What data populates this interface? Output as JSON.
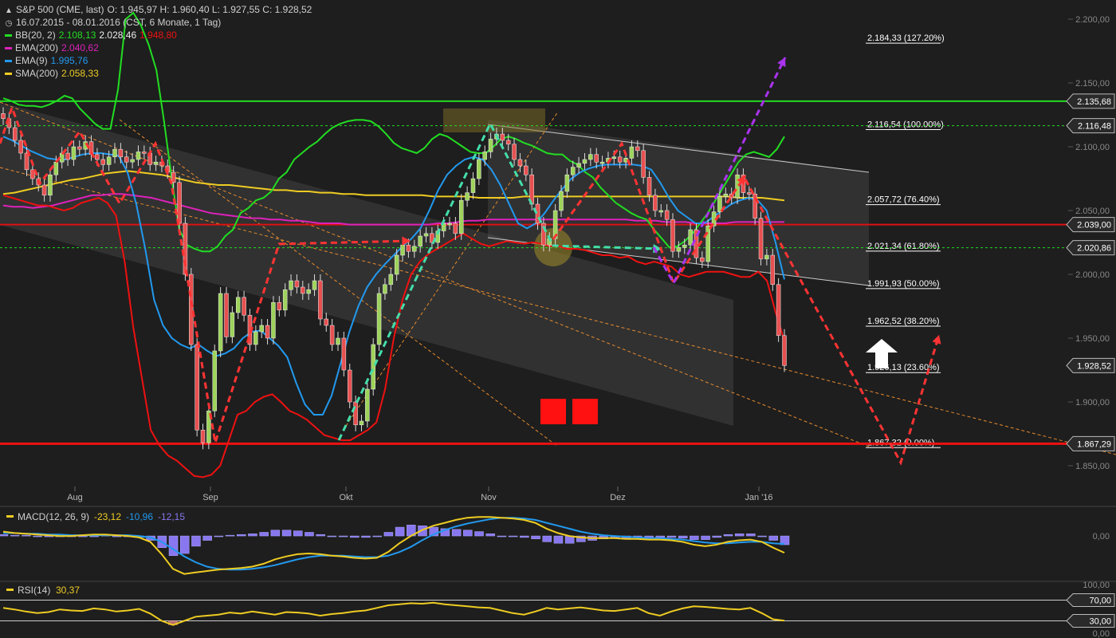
{
  "header": {
    "instrument": "S&P 500 (CME, last)",
    "ohlc": "O: 1.945,97  H: 1.960,40  L: 1.927,55  C: 1.928,52",
    "range": "16.07.2015 - 08.01.2016 (CST, 6 Monate, 1 Tag)",
    "indicators": [
      {
        "label": "BB(20, 2)",
        "values": [
          "2.108,13",
          "2.028,46",
          "1.948,80"
        ],
        "colors": [
          "#22dd22",
          "#eeeeee",
          "#ee1111"
        ]
      },
      {
        "label": "EMA(200)",
        "values": [
          "2.040,62"
        ],
        "colors": [
          "#dd22bb"
        ]
      },
      {
        "label": "EMA(9)",
        "values": [
          "1.995,76"
        ],
        "colors": [
          "#2299ee"
        ]
      },
      {
        "label": "SMA(200)",
        "values": [
          "2.058,33"
        ],
        "colors": [
          "#eecc22"
        ]
      }
    ]
  },
  "colors": {
    "background": "#1e1e1e",
    "grid": "#333333",
    "bb": "#22dd22",
    "bb_lower": "#ee1111",
    "ema200": "#dd22bb",
    "ema9": "#2299ee",
    "sma200": "#eecc22",
    "up": "#9ed35a",
    "down": "#e85050",
    "fib": "#ffffff"
  },
  "chart_data": [
    {
      "type": "candlestick",
      "title": "S&P 500 (CME, last)",
      "x_ticks": [
        "Aug",
        "Sep",
        "Okt",
        "Nov",
        "Dez",
        "Jan '16"
      ],
      "y_ticks": [
        "2.200,00",
        "2.150,00",
        "2.100,00",
        "2.050,00",
        "2.000,00",
        "1.950,00",
        "1.900,00",
        "1.850,00"
      ],
      "ylim": [
        1835,
        2215
      ],
      "grid": false,
      "series": [
        {
          "name": "Close",
          "values": [
            2122,
            2115,
            2105,
            2095,
            2082,
            2075,
            2070,
            2062,
            2078,
            2088,
            2095,
            2090,
            2100,
            2098,
            2104,
            2094,
            2090,
            2086,
            2092,
            2098,
            2092,
            2088,
            2090,
            2096,
            2095,
            2086,
            2088,
            2085,
            2080,
            2072,
            2040,
            2000,
            1945,
            1878,
            1868,
            1893,
            1940,
            1985,
            1951,
            1970,
            1982,
            1968,
            1945,
            1955,
            1960,
            1950,
            1978,
            1972,
            1988,
            1995,
            1990,
            1985,
            1988,
            1995,
            1965,
            1960,
            1945,
            1950,
            1925,
            1900,
            1882,
            1885,
            1910,
            1945,
            1985,
            1992,
            2000,
            2015,
            2023,
            2018,
            2022,
            2030,
            2032,
            2025,
            2034,
            2040,
            2040,
            2032,
            2058,
            2064,
            2075,
            2090,
            2096,
            2106,
            2110,
            2105,
            2102,
            2090,
            2085,
            2078,
            2055,
            2040,
            2023,
            2028,
            2050,
            2065,
            2078,
            2084,
            2087,
            2090,
            2094,
            2088,
            2088,
            2091,
            2092,
            2088,
            2091,
            2100,
            2097,
            2076,
            2062,
            2050,
            2050,
            2043,
            2018,
            2021,
            2023,
            2035,
            2013,
            2010,
            2038,
            2049,
            2061,
            2063,
            2060,
            2078,
            2064,
            2063,
            2044,
            2012,
            2015,
            1992,
            1952,
            1928.52
          ]
        },
        {
          "name": "BB upper",
          "values": [
            2138,
            2136,
            2133,
            2132,
            2132,
            2131,
            2133,
            2136,
            2140,
            2138,
            2130,
            2124,
            2118,
            2114,
            2114,
            2145,
            2200,
            2205,
            2195,
            2180,
            2160,
            2120,
            2075,
            2035,
            2023,
            2020,
            2018,
            2018,
            2022,
            2030,
            2035,
            2048,
            2052,
            2058,
            2060,
            2065,
            2075,
            2080,
            2090,
            2095,
            2100,
            2104,
            2110,
            2115,
            2118,
            2120,
            2121,
            2121,
            2120,
            2116,
            2110,
            2103,
            2099,
            2097,
            2095,
            2099,
            2106,
            2110,
            2108,
            2104,
            2100,
            2096,
            2095,
            2095,
            2100,
            2106,
            2108,
            2106,
            2103,
            2101,
            2098,
            2095,
            2094,
            2094,
            2089,
            2086,
            2080,
            2076,
            2068,
            2062,
            2056,
            2052,
            2048,
            2045,
            2043,
            2035,
            2028,
            2021,
            2022,
            2026,
            2032,
            2040,
            2048,
            2058,
            2068,
            2078,
            2088,
            2094,
            2096,
            2094,
            2092,
            2098,
            2108
          ]
        },
        {
          "name": "BB lower",
          "values": [
            2062,
            2060,
            2058,
            2056,
            2054,
            2054,
            2052,
            2050,
            2052,
            2056,
            2058,
            2060,
            2056,
            2046,
            2010,
            1958,
            1918,
            1878,
            1866,
            1858,
            1854,
            1848,
            1842,
            1841,
            1843,
            1850,
            1870,
            1890,
            1893,
            1900,
            1904,
            1906,
            1900,
            1893,
            1890,
            1886,
            1880,
            1874,
            1872,
            1870,
            1870,
            1874,
            1878,
            1884,
            1910,
            1950,
            1980,
            2000,
            2010,
            2016,
            2020,
            2024,
            2028,
            2032,
            2028,
            2024,
            2022,
            2024,
            2026,
            2025,
            2024,
            2025,
            2024,
            2022,
            2022,
            2020,
            2020,
            2019,
            2017,
            2015,
            2015,
            2013,
            2014,
            2010,
            2008,
            2010,
            2008,
            2006,
            2000,
            1998,
            2000,
            2002,
            2002,
            2002,
            2000,
            1998,
            1998,
            2002,
            1995,
            1970,
            1948
          ]
        },
        {
          "name": "EMA(200)",
          "values": [
            2054,
            2053,
            2053,
            2052,
            2053,
            2054,
            2056,
            2058,
            2060,
            2062,
            2062,
            2063,
            2063,
            2062,
            2061,
            2060,
            2058,
            2056,
            2054,
            2052,
            2050,
            2048,
            2047,
            2046,
            2045,
            2044,
            2044,
            2043,
            2043,
            2042,
            2042,
            2041,
            2040,
            2040,
            2040,
            2039,
            2039,
            2039,
            2039,
            2039,
            2039,
            2039,
            2039,
            2039,
            2040,
            2040,
            2041,
            2042,
            2042,
            2043,
            2043,
            2043,
            2043,
            2043,
            2043,
            2043,
            2043,
            2043,
            2043,
            2043,
            2043,
            2043,
            2043,
            2043,
            2042,
            2042,
            2042,
            2041,
            2041,
            2041,
            2040,
            2040,
            2040,
            2040,
            2041,
            2041,
            2041,
            2041,
            2041,
            2041
          ]
        },
        {
          "name": "SMA(200)",
          "values": [
            2063,
            2064,
            2066,
            2068,
            2070,
            2072,
            2074,
            2075,
            2077,
            2079,
            2080,
            2081,
            2080,
            2079,
            2078,
            2076,
            2074,
            2072,
            2071,
            2070,
            2070,
            2069,
            2068,
            2067,
            2066,
            2066,
            2065,
            2065,
            2064,
            2064,
            2063,
            2063,
            2062,
            2062,
            2062,
            2062,
            2062,
            2062,
            2061,
            2061,
            2061,
            2061,
            2060,
            2060,
            2060,
            2060,
            2061,
            2061,
            2061,
            2061,
            2061,
            2061,
            2061,
            2061,
            2061,
            2061,
            2061,
            2061,
            2061,
            2061,
            2061,
            2061,
            2061,
            2061,
            2061,
            2060,
            2060,
            2060,
            2059,
            2058
          ]
        },
        {
          "name": "EMA(9)",
          "values": [
            2108,
            2105,
            2101,
            2097,
            2094,
            2091,
            2090,
            2090,
            2092,
            2094,
            2095,
            2095,
            2094,
            2093,
            2080,
            2055,
            2020,
            1980,
            1960,
            1950,
            1945,
            1942,
            1945,
            1940,
            1936,
            1938,
            1942,
            1950,
            1955,
            1956,
            1950,
            1944,
            1935,
            1915,
            1898,
            1890,
            1890,
            1905,
            1930,
            1955,
            1975,
            1990,
            2000,
            2008,
            2015,
            2022,
            2028,
            2036,
            2050,
            2066,
            2078,
            2085,
            2090,
            2092,
            2090,
            2082,
            2070,
            2055,
            2040,
            2036,
            2040,
            2048,
            2058,
            2067,
            2075,
            2080,
            2083,
            2085,
            2086,
            2086,
            2086,
            2086,
            2085,
            2082,
            2072,
            2060,
            2050,
            2045,
            2040,
            2040,
            2045,
            2050,
            2055,
            2058,
            2060,
            2058,
            2050,
            2025,
            1996
          ]
        }
      ],
      "drawn_levels": [
        "2.135,68",
        "2.116,48",
        "2.039,00",
        "2.020,86",
        "1.867,29"
      ],
      "last_price": "1.928,52",
      "fibonacci": [
        {
          "level": 2184.33,
          "label": "2.184,33 (127.20%)"
        },
        {
          "level": 2116.54,
          "label": "2.116,54 (100.00%)"
        },
        {
          "level": 2057.72,
          "label": "2.057,72 (76.40%)"
        },
        {
          "level": 2021.34,
          "label": "2.021,34 (61.80%)"
        },
        {
          "level": 1991.93,
          "label": "1.991,93 (50.00%)"
        },
        {
          "level": 1962.52,
          "label": "1.962,52 (38.20%)"
        },
        {
          "level": 1926.13,
          "label": "1.926,13 (23.60%)"
        },
        {
          "level": 1867.32,
          "label": "1.867,32 (0.00%)"
        }
      ]
    },
    {
      "type": "bar+line",
      "title": "MACD(12, 26, 9)",
      "label": "MACD(12, 26, 9)",
      "values_text": [
        "-23,12",
        "-10,96",
        "-12,15"
      ],
      "value_colors": [
        "#eecc22",
        "#2299ee",
        "#8877ee"
      ],
      "y_ticks": [
        "0,00"
      ],
      "ylim": [
        -60,
        35
      ],
      "series": [
        {
          "name": "MACD",
          "values": [
            6,
            4,
            3,
            2,
            1,
            0,
            0,
            1,
            2,
            2,
            1,
            0,
            -2,
            -8,
            -25,
            -45,
            -52,
            -50,
            -48,
            -46,
            -45,
            -44,
            -42,
            -38,
            -32,
            -28,
            -25,
            -24,
            -25,
            -27,
            -28,
            -30,
            -31,
            -30,
            -22,
            -10,
            0,
            8,
            14,
            18,
            22,
            25,
            26,
            26,
            25,
            24,
            22,
            18,
            10,
            4,
            0,
            -2,
            -3,
            -3,
            -3,
            -4,
            -4,
            -5,
            -5,
            -6,
            -8,
            -12,
            -14,
            -12,
            -8,
            -6,
            -5,
            -8,
            -16,
            -23
          ]
        },
        {
          "name": "Signal",
          "values": [
            4,
            4,
            3,
            3,
            2,
            2,
            1,
            1,
            1,
            1,
            1,
            1,
            0,
            -2,
            -8,
            -18,
            -28,
            -36,
            -42,
            -45,
            -46,
            -46,
            -45,
            -43,
            -40,
            -36,
            -32,
            -29,
            -27,
            -27,
            -27,
            -28,
            -29,
            -29,
            -27,
            -22,
            -15,
            -6,
            2,
            8,
            13,
            17,
            20,
            23,
            25,
            25,
            24,
            22,
            18,
            14,
            10,
            6,
            3,
            1,
            0,
            -1,
            -2,
            -3,
            -3,
            -4,
            -5,
            -7,
            -9,
            -10,
            -10,
            -9,
            -8,
            -8,
            -10,
            -11
          ]
        },
        {
          "name": "Histogram",
          "values": [
            2,
            1,
            1,
            0,
            0,
            -1,
            -1,
            0,
            0,
            1,
            0,
            -1,
            -2,
            -6,
            -16,
            -27,
            -24,
            -14,
            -6,
            -1,
            1,
            2,
            3,
            5,
            8,
            8,
            7,
            5,
            2,
            0,
            -1,
            -2,
            -2,
            -1,
            5,
            12,
            15,
            14,
            12,
            10,
            9,
            8,
            6,
            3,
            0,
            -1,
            -2,
            -4,
            -8,
            -10,
            -10,
            -8,
            -6,
            -4,
            -3,
            -3,
            -2,
            -2,
            -2,
            -2,
            -3,
            -5,
            -5,
            -2,
            2,
            3,
            3,
            0,
            -6,
            -12
          ]
        }
      ]
    },
    {
      "type": "line",
      "title": "RSI(14)",
      "label": "RSI(14)",
      "value_text": "30,37",
      "value_color": "#eecc22",
      "y_ticks": [
        "100,00",
        "70,00",
        "30,00",
        "0,00"
      ],
      "ylim": [
        0,
        100
      ],
      "series": [
        {
          "name": "RSI(14)",
          "values": [
            55,
            52,
            48,
            45,
            47,
            52,
            50,
            49,
            54,
            52,
            48,
            50,
            53,
            44,
            30,
            22,
            30,
            38,
            40,
            42,
            46,
            44,
            48,
            45,
            42,
            47,
            46,
            44,
            40,
            43,
            45,
            48,
            50,
            55,
            60,
            62,
            64,
            63,
            65,
            62,
            60,
            58,
            56,
            55,
            50,
            45,
            42,
            48,
            55,
            52,
            54,
            56,
            53,
            50,
            49,
            52,
            55,
            45,
            40,
            48,
            54,
            58,
            57,
            55,
            53,
            52,
            55,
            45,
            33,
            30.37
          ]
        }
      ]
    }
  ],
  "annotations": {
    "wave_arrows": true,
    "channels": true
  }
}
